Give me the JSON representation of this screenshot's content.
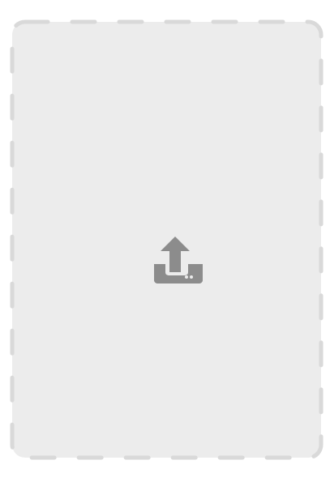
{
  "dropzone": {
    "background_color": "#ececec",
    "border_color": "#d9d9d9",
    "border_style": "dashed"
  },
  "upload": {
    "icon": "upload-icon",
    "icon_color": "#8c8c8c"
  }
}
